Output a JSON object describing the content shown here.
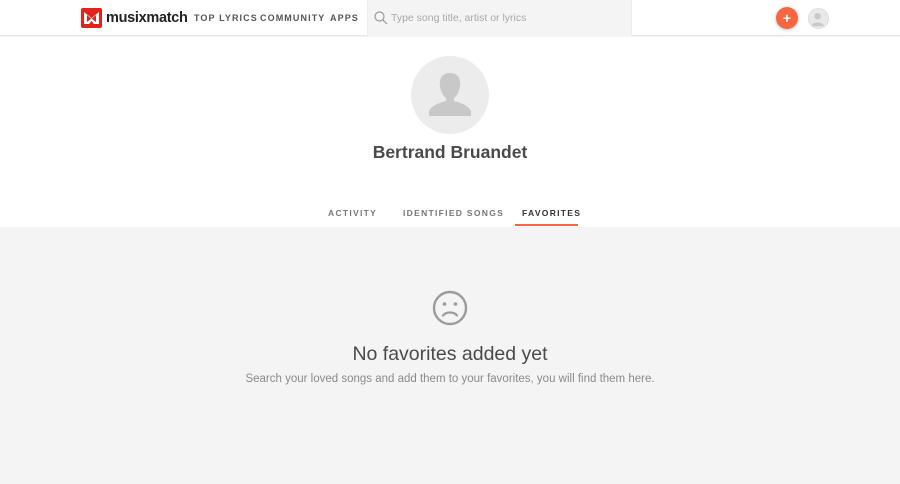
{
  "header": {
    "logo_text": "musixmatch",
    "nav": [
      "TOP LYRICS",
      "COMMUNITY",
      "APPS"
    ],
    "search_placeholder": "Type song title, artist or lyrics",
    "add_label": "+"
  },
  "profile": {
    "name": "Bertrand Bruandet"
  },
  "tabs": [
    "ACTIVITY",
    "IDENTIFIED SONGS",
    "FAVORITES"
  ],
  "active_tab": "FAVORITES",
  "empty_state": {
    "title": "No favorites added yet",
    "subtitle": "Search your loved songs and add them to your favorites, you will find them here."
  },
  "colors": {
    "accent": "#f76641",
    "brand": "#e2231a"
  }
}
